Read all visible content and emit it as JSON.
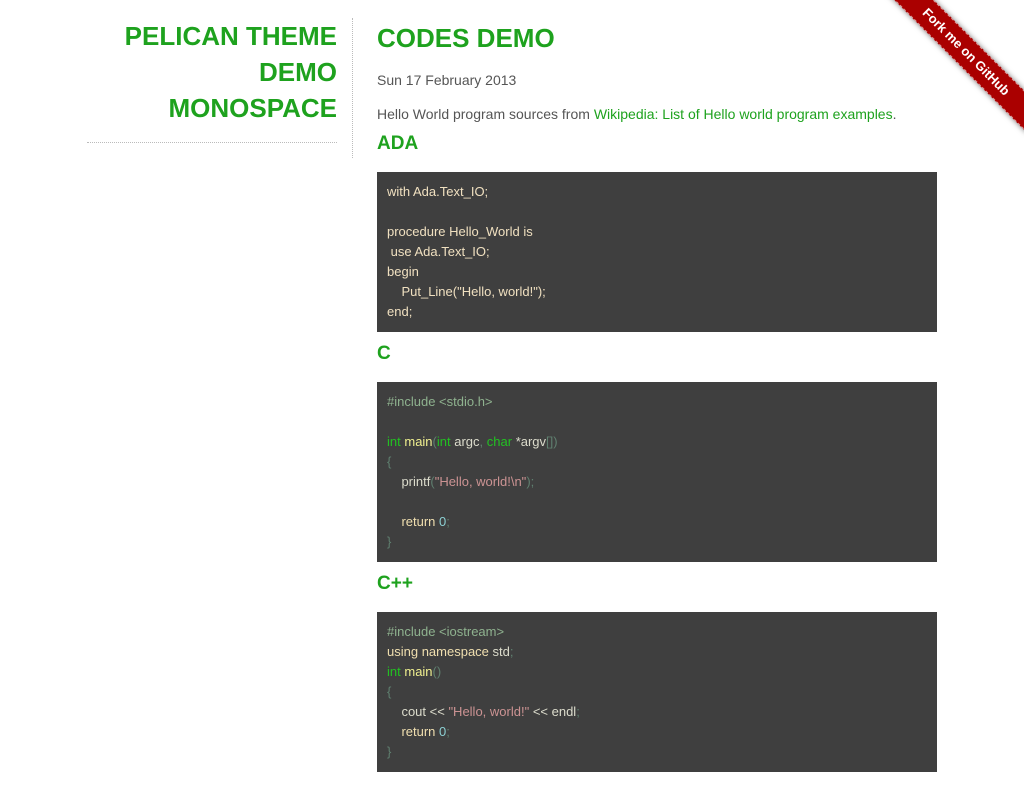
{
  "sidebar": {
    "site_title_line1": "PELICAN THEME",
    "site_title_line2": "DEMO",
    "site_title_line3": "MONOSPACE"
  },
  "main": {
    "title": "CODES DEMO",
    "date": "Sun 17 February 2013",
    "intro_text": "Hello World program sources from ",
    "intro_link": "Wikipedia: List of Hello world program examples",
    "intro_suffix": "."
  },
  "sections": [
    {
      "heading": "ADA",
      "lines": [
        [
          [
            "fg",
            "with Ada.Text_IO;"
          ]
        ],
        [],
        [
          [
            "fg",
            "procedure Hello_World is"
          ]
        ],
        [
          [
            "fg",
            " use Ada.Text_IO;"
          ]
        ],
        [
          [
            "fg",
            "begin"
          ]
        ],
        [
          [
            "fg",
            "    Put_Line(\"Hello, world!\");"
          ]
        ],
        [
          [
            "fg",
            "end;"
          ]
        ]
      ]
    },
    {
      "heading": "C",
      "lines": [
        [
          [
            "pre",
            "#include <stdio.h>"
          ]
        ],
        [],
        [
          [
            "type",
            "int"
          ],
          [
            "plain",
            " "
          ],
          [
            "fn",
            "main"
          ],
          [
            "punct",
            "("
          ],
          [
            "type",
            "int"
          ],
          [
            "plain",
            " argc"
          ],
          [
            "punct",
            ","
          ],
          [
            "plain",
            " "
          ],
          [
            "type",
            "char"
          ],
          [
            "plain",
            " *argv"
          ],
          [
            "punct",
            "[])"
          ]
        ],
        [
          [
            "punct",
            "{"
          ]
        ],
        [
          [
            "plain",
            "    printf"
          ],
          [
            "punct",
            "("
          ],
          [
            "str",
            "\"Hello, world!\\n\""
          ],
          [
            "punct",
            ");"
          ]
        ],
        [],
        [
          [
            "plain",
            "    "
          ],
          [
            "kw",
            "return"
          ],
          [
            "plain",
            " "
          ],
          [
            "num",
            "0"
          ],
          [
            "punct",
            ";"
          ]
        ],
        [
          [
            "punct",
            "}"
          ]
        ]
      ]
    },
    {
      "heading": "C++",
      "lines": [
        [
          [
            "pre",
            "#include <iostream>"
          ]
        ],
        [
          [
            "kw",
            "using namespace"
          ],
          [
            "plain",
            " std"
          ],
          [
            "punct",
            ";"
          ]
        ],
        [
          [
            "type",
            "int"
          ],
          [
            "plain",
            " "
          ],
          [
            "fn",
            "main"
          ],
          [
            "punct",
            "()"
          ]
        ],
        [
          [
            "punct",
            "{"
          ]
        ],
        [
          [
            "plain",
            "    cout << "
          ],
          [
            "str",
            "\"Hello, world!\""
          ],
          [
            "plain",
            " << endl"
          ],
          [
            "punct",
            ";"
          ]
        ],
        [
          [
            "plain",
            "    "
          ],
          [
            "kw",
            "return"
          ],
          [
            "plain",
            " "
          ],
          [
            "num",
            "0"
          ],
          [
            "punct",
            ";"
          ]
        ],
        [
          [
            "punct",
            "}"
          ]
        ]
      ]
    }
  ],
  "ribbon": {
    "label": "Fork me on GitHub",
    "color": "#aa0000"
  },
  "colors": {
    "accent": "#1ea21e",
    "code_bg": "#3f3f3f"
  }
}
